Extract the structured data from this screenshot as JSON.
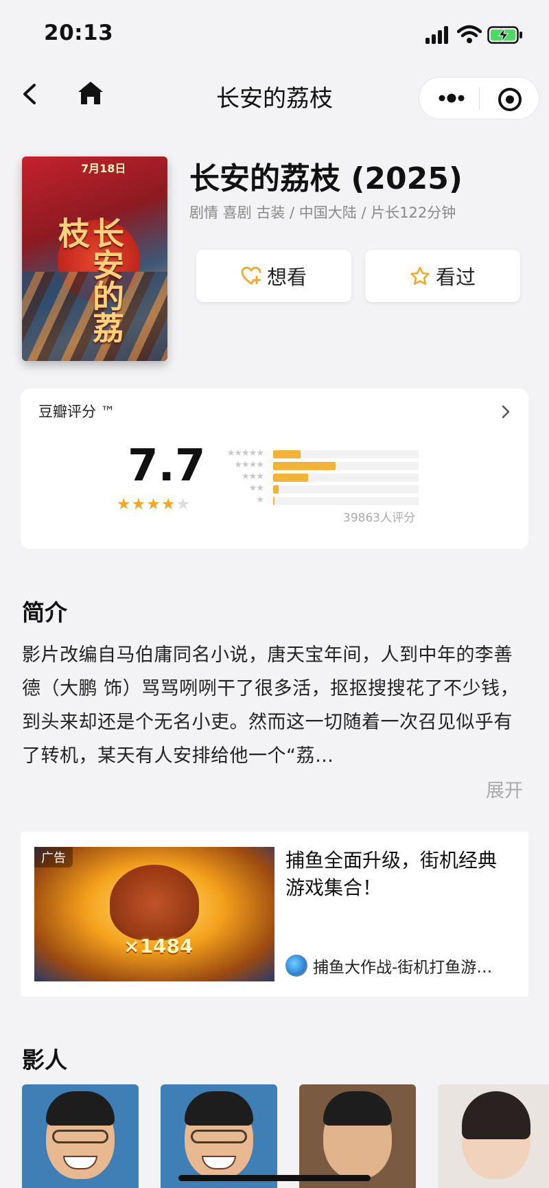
{
  "status_bar": {
    "time": "20:13"
  },
  "nav": {
    "title": "长安的荔枝"
  },
  "movie": {
    "title": "长安的荔枝 (2025)",
    "meta": "剧情 喜剧 古装 / 中国大陆 / 片长122分钟",
    "poster": {
      "date_text": "7月18日",
      "title_text": "长安的荔枝"
    },
    "want_label": "想看",
    "seen_label": "看过"
  },
  "rating": {
    "label": "豆瓣评分 ™",
    "score": "7.7",
    "stars": 4,
    "stars_max": 5,
    "votes_text": "39863人评分",
    "distribution": [
      {
        "stars": 5,
        "fraction": 0.19
      },
      {
        "stars": 4,
        "fraction": 0.43
      },
      {
        "stars": 3,
        "fraction": 0.24
      },
      {
        "stars": 2,
        "fraction": 0.04
      },
      {
        "stars": 1,
        "fraction": 0.01
      }
    ],
    "colors": {
      "accent": "#f5a623",
      "bar": "#f5b335"
    }
  },
  "intro": {
    "title": "简介",
    "text": "影片改编自马伯庸同名小说，唐天宝年间，人到中年的李善德（大鹏 饰）骂骂咧咧干了很多活，抠抠搜搜花了不少钱，到头来却还是个无名小吏。然而这一切随着一次召见似乎有了转机，某天有人安排给他一个“荔…",
    "expand_label": "展开"
  },
  "ad": {
    "badge": "广告",
    "image_text": "×1484",
    "title": "捕鱼全面升级，街机经典游戏集合！",
    "app_name": "捕鱼大作战-街机打鱼游…"
  },
  "cast": {
    "title": "影人",
    "members": [
      {
        "bg": "#3f7fb5"
      },
      {
        "bg": "#3f7fb5"
      },
      {
        "bg": "#7a5a40"
      },
      {
        "bg": "#e9e4df"
      }
    ]
  }
}
